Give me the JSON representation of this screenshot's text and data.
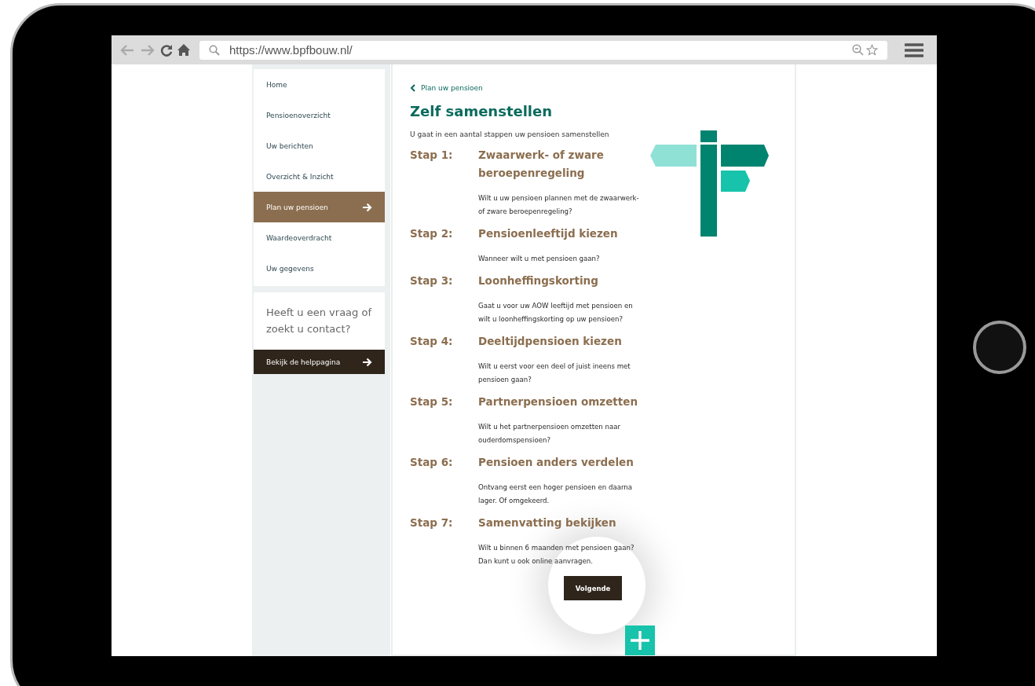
{
  "browser": {
    "url": "https://www.bpfbouw.nl/"
  },
  "sidebar": {
    "items": [
      {
        "label": "Home",
        "selected": false
      },
      {
        "label": "Pensioenoverzicht",
        "selected": false
      },
      {
        "label": "Uw berichten",
        "selected": false
      },
      {
        "label": "Overzicht & Inzicht",
        "selected": false
      },
      {
        "label": "Plan uw pensioen",
        "selected": true
      },
      {
        "label": "Waardeoverdracht",
        "selected": false
      },
      {
        "label": "Uw gegevens",
        "selected": false
      }
    ],
    "help": {
      "text": "Heeft u een vraag of zoekt u contact?",
      "button": "Bekijk de helppagina"
    }
  },
  "main": {
    "back_link": "Plan uw pensioen",
    "title": "Zelf samenstellen",
    "intro": "U gaat in een aantal stappen uw pensioen samenstellen",
    "steps": [
      {
        "label": "Stap 1:",
        "title": "Zwaarwerk- of zware beroepenregeling",
        "description": "Wilt u uw pensioen plannen met de zwaarwerk- of zware beroepenregeling?"
      },
      {
        "label": "Stap 2:",
        "title": "Pensioenleeftijd kiezen",
        "description": "Wanneer wilt u met pensioen gaan?"
      },
      {
        "label": "Stap 3:",
        "title": "Loonheffingskorting",
        "description": "Gaat u voor uw AOW leeftijd met pensioen en wilt u loonheffingskorting op uw pensioen?"
      },
      {
        "label": "Stap 4:",
        "title": "Deeltijdpensioen kiezen",
        "description": "Wilt u eerst voor een deel of juist ineens met pensioen gaan?"
      },
      {
        "label": "Stap 5:",
        "title": "Partnerpensioen omzetten",
        "description": "Wilt u het partnerpensioen omzetten naar ouderdomspensioen?"
      },
      {
        "label": "Stap 6:",
        "title": "Pensioen anders verdelen",
        "description": "Ontvang eerst een hoger pensioen en daarna lager. Of omgekeerd."
      },
      {
        "label": "Stap 7:",
        "title": "Samenvatting bekijken",
        "description": "Wilt u binnen 6 maanden met pensioen gaan? Dan kunt u ook online aanvragen."
      }
    ],
    "next_button": "Volgende"
  }
}
